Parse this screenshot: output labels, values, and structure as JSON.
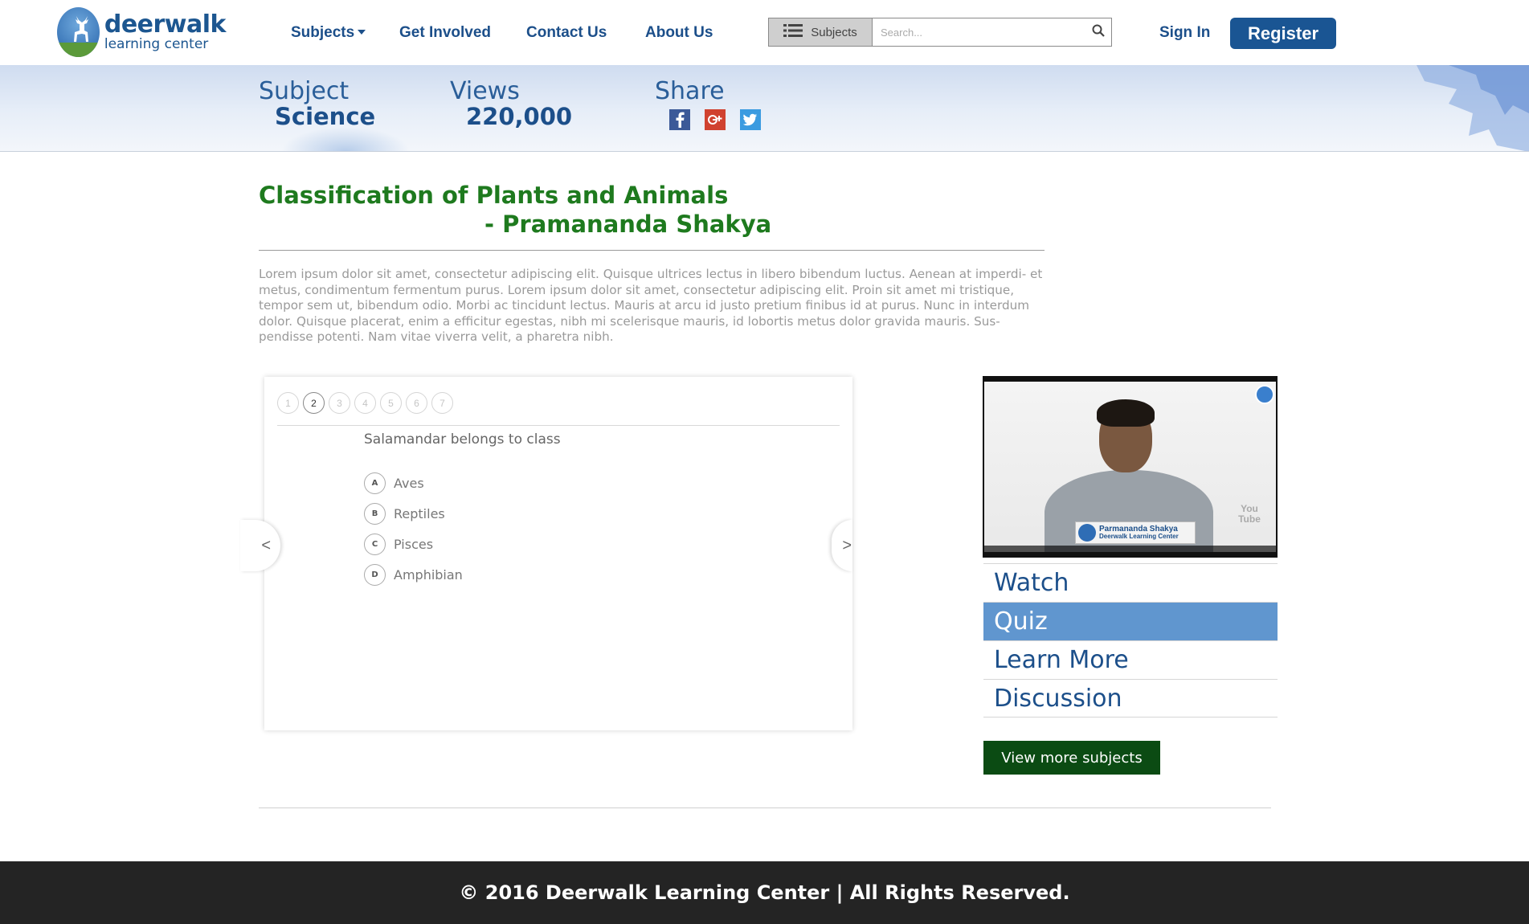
{
  "brand": {
    "title": "deerwalk",
    "subtitle": "learning center"
  },
  "nav": {
    "subjects": "Subjects",
    "get_involved": "Get Involved",
    "contact": "Contact Us",
    "about": "About Us"
  },
  "search": {
    "category": "Subjects",
    "placeholder": "Search..."
  },
  "auth": {
    "sign_in": "Sign In",
    "register": "Register"
  },
  "banner": {
    "subject_label": "Subject",
    "subject_value": "Science",
    "views_label": "Views",
    "views_value": "220,000",
    "share_label": "Share",
    "social": [
      "facebook-icon",
      "google-plus-icon",
      "twitter-icon"
    ]
  },
  "lesson": {
    "title": "Classification of Plants and Animals",
    "author": "- Pramananda Shakya",
    "description": "Lorem ipsum dolor sit amet, consectetur adipiscing elit. Quisque ultrices lectus in libero bibendum luctus. Aenean at imperdi- et metus, condimentum fermentum purus. Lorem ipsum dolor sit amet, consectetur adipiscing elit. Proin sit amet mi tristique, tempor sem ut, bibendum odio. Morbi ac tincidunt lectus. Mauris at arcu id justo pretium finibus id at purus. Nunc in interdum dolor. Quisque placerat, enim a efficitur egestas, nibh mi scelerisque mauris, id lobortis metus dolor gravida mauris. Sus- pendisse potenti. Nam vitae viverra velit, a pharetra nibh."
  },
  "quiz": {
    "steps": [
      "1",
      "2",
      "3",
      "4",
      "5",
      "6",
      "7"
    ],
    "active_step": 2,
    "question": "Salamandar belongs to class",
    "options": [
      {
        "letter": "A",
        "text": "Aves"
      },
      {
        "letter": "B",
        "text": "Reptiles"
      },
      {
        "letter": "C",
        "text": "Pisces"
      },
      {
        "letter": "D",
        "text": "Amphibian"
      }
    ],
    "prev": "<",
    "next": ">"
  },
  "video": {
    "presenter_name": "Parmananda Shakya",
    "presenter_org": "Deerwalk Learning Center",
    "platform": "You Tube"
  },
  "video_menu": {
    "items": [
      "Watch",
      "Quiz",
      "Learn More",
      "Discussion"
    ],
    "active": "Quiz"
  },
  "more_subjects": "View more subjects",
  "footer": {
    "copyright": "© 2016 Deerwalk Learning Center | All Rights Reserved."
  },
  "colors": {
    "brand_blue": "#1c4f8a",
    "register_bg": "#1a5593",
    "title_green": "#1e7a1e",
    "menu_active": "#6096cf",
    "more_btn_bg": "#0b4b13",
    "footer_bg": "#242424"
  }
}
